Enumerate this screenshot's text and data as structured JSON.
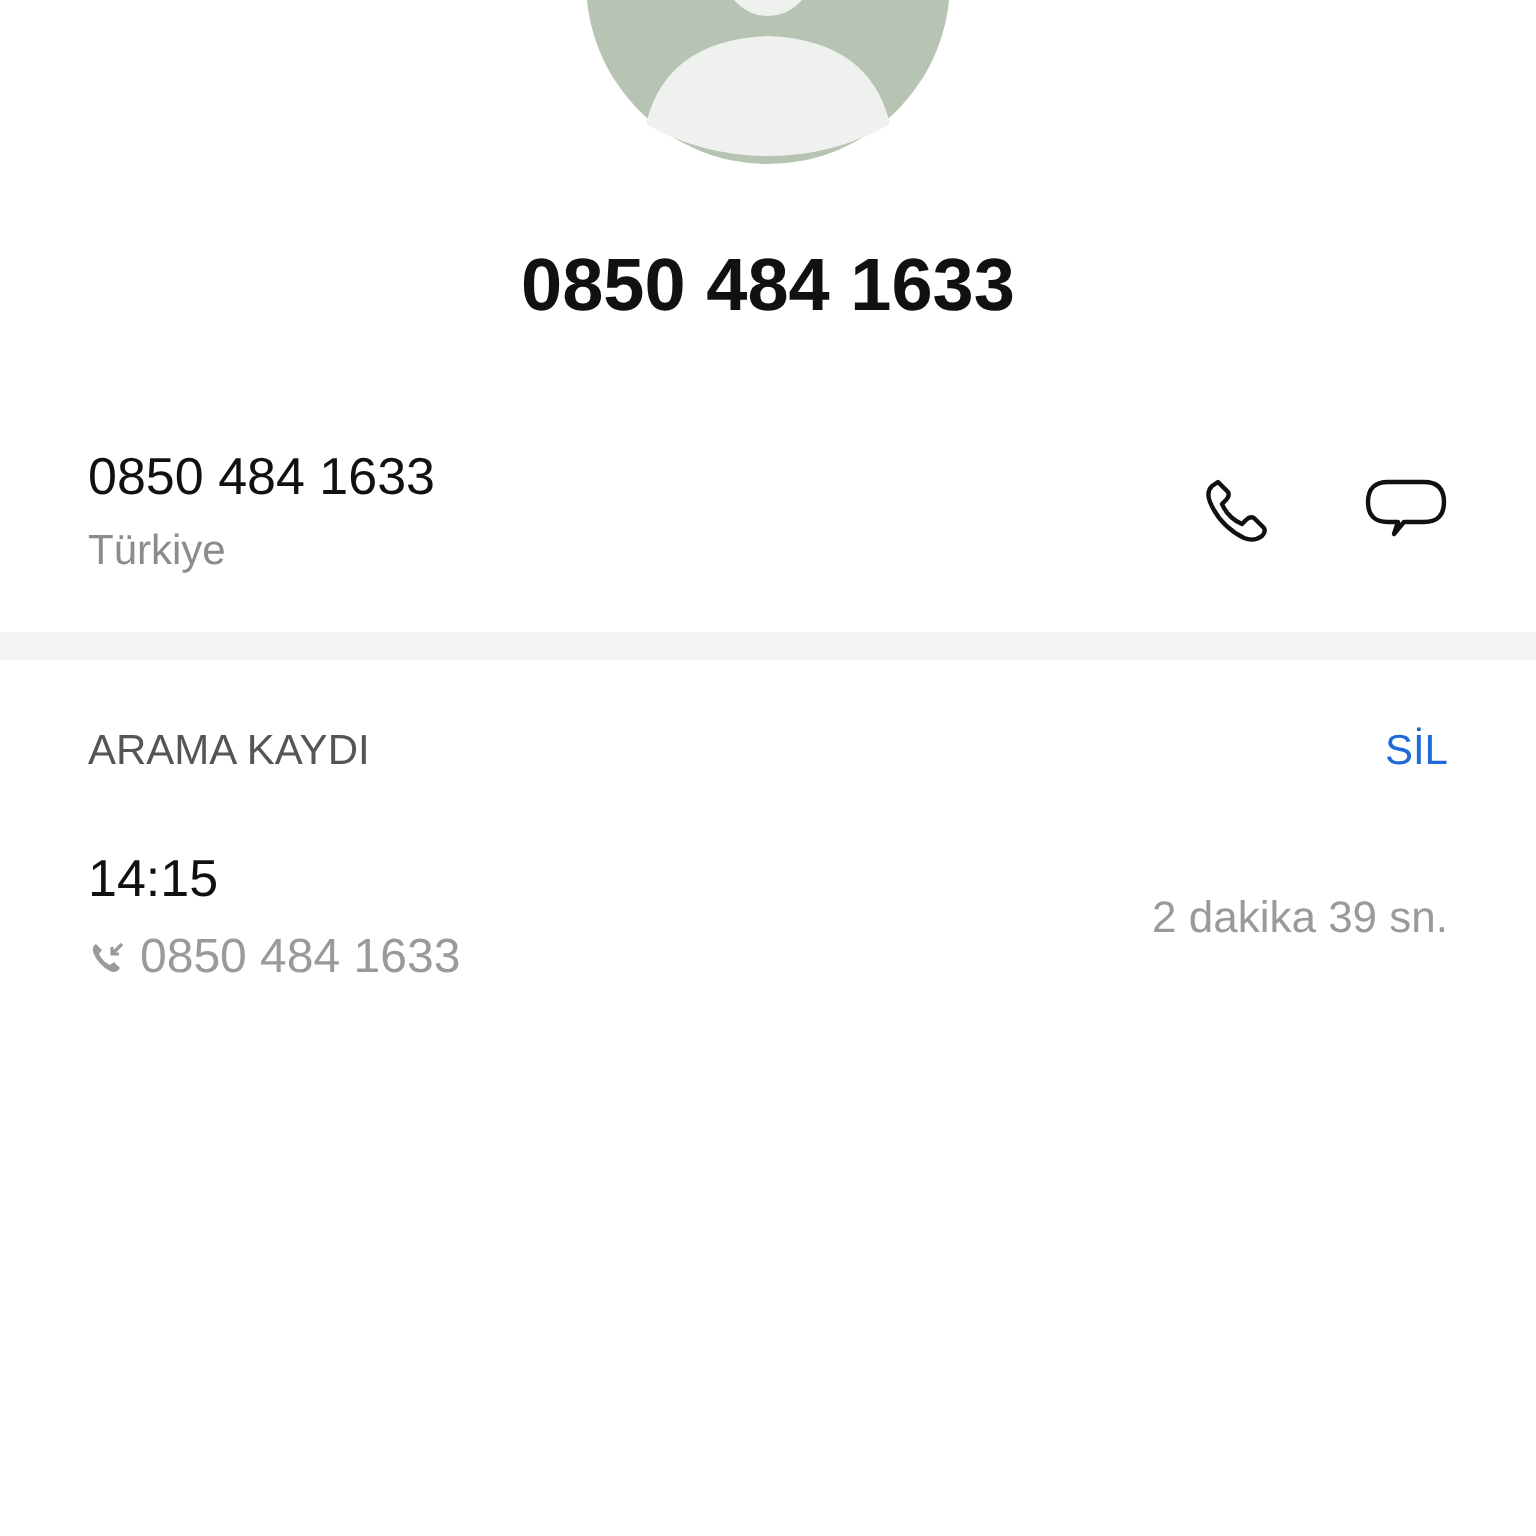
{
  "contact": {
    "title": "0850 484 1633"
  },
  "number": {
    "value": "0850 484 1633",
    "region": "Türkiye"
  },
  "call_log": {
    "heading": "ARAMA KAYDI",
    "delete_label": "SİL",
    "entries": [
      {
        "time": "14:15",
        "kind": "incoming",
        "number": "0850 484 1633",
        "duration": "2 dakika 39 sn."
      }
    ]
  }
}
